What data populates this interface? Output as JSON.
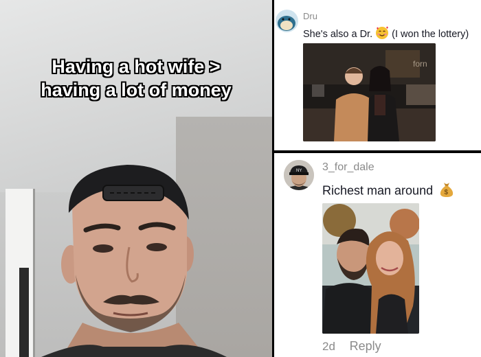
{
  "video": {
    "caption_line1": "Having a hot wife >",
    "caption_line2": "having a lot of money"
  },
  "comments": [
    {
      "username": "Dru",
      "text": "She's also a Dr.",
      "text_suffix": "(I won the lottery)",
      "avatar_icon": "snorlax-avatar-icon",
      "photo_sign": "forn"
    },
    {
      "username": "3_for_dale",
      "text": "Richest man around",
      "avatar_icon": "man-in-cap-avatar-icon",
      "age": "2d",
      "reply_label": "Reply"
    }
  ],
  "colors": {
    "divider": "#000000",
    "username": "#8a8a8a",
    "comment_text": "#161823"
  }
}
